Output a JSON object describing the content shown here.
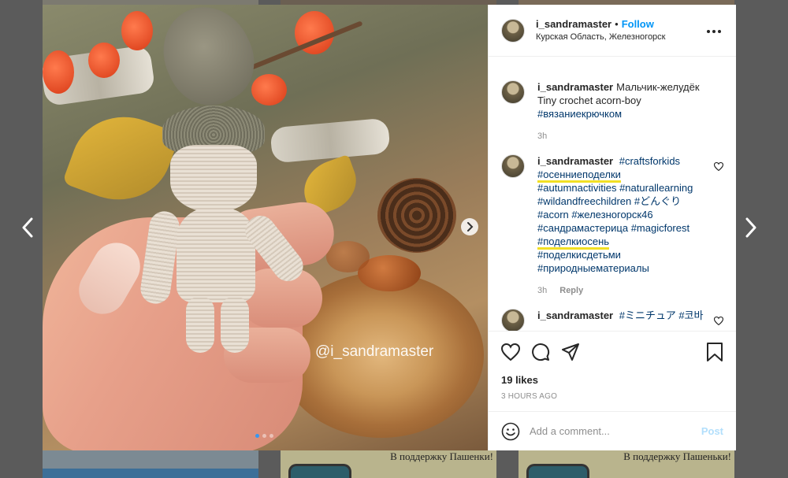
{
  "post": {
    "watermark": "@i_sandramaster",
    "slides_total": 3,
    "slide_active": 1
  },
  "header": {
    "username": "i_sandramaster",
    "separator": "•",
    "follow_label": "Follow",
    "location": "Курская Область, Железногорск",
    "more_icon": "more-horizontal-icon"
  },
  "caption": {
    "username": "i_sandramaster",
    "line1": "Мальчик-желудёк",
    "line2": "Tiny crochet acorn-boy",
    "tag": "#вязаниекрючком",
    "time": "3h"
  },
  "comment1": {
    "username": "i_sandramaster",
    "tags": [
      "#craftsforkids",
      "#осенниеподелки",
      "#autumnactivities",
      "#naturallearning",
      "#wildandfreechildren",
      "#どんぐり",
      "#acorn",
      "#железногорск46",
      "#сандрамастерица",
      "#magicforest",
      "#поделкиосень",
      "#поделкисдетьми",
      "#природныематериалы"
    ],
    "highlighted": [
      "#осенниеподелки",
      "#поделкиосень"
    ],
    "time": "3h",
    "reply_label": "Reply"
  },
  "comment2": {
    "username": "i_sandramaster",
    "text": "#ミニチュア #코바"
  },
  "actions": {
    "likes": "19 likes",
    "timestamp": "3 HOURS AGO"
  },
  "add_comment": {
    "placeholder": "Add a comment...",
    "post_label": "Post"
  },
  "background": {
    "caption_mid": "В поддержку Пашенки!",
    "caption_right": "В поддержку Пашеньки!"
  },
  "colors": {
    "link": "#0095f6",
    "hashtag": "#00376b",
    "highlight": "#f2e024",
    "overlay": "#5b5b5b"
  }
}
